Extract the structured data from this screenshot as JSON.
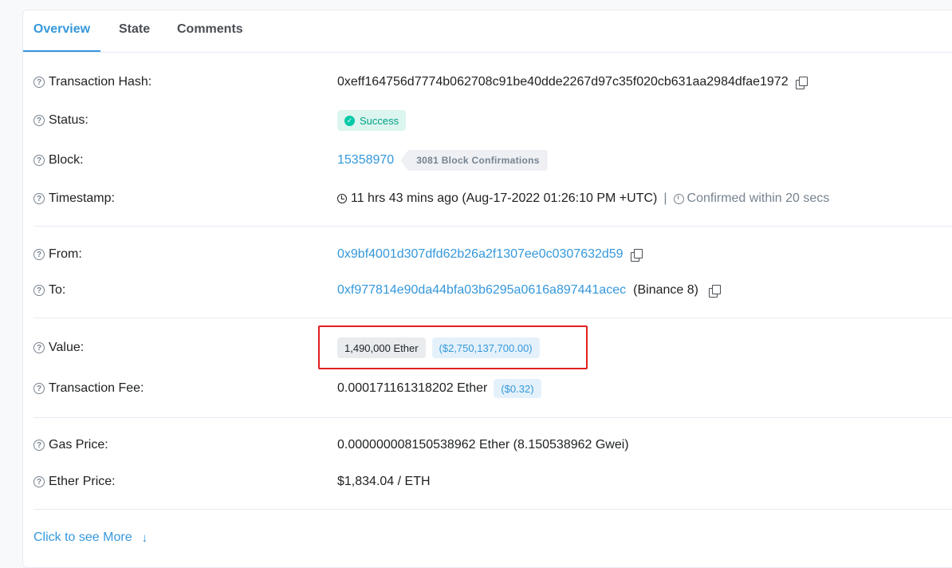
{
  "tabs": [
    "Overview",
    "State",
    "Comments"
  ],
  "rows": {
    "tx_hash": {
      "label": "Transaction Hash:",
      "value": "0xeff164756d7774b062708c91be40dde2267d97c35f020cb631aa2984dfae1972"
    },
    "status": {
      "label": "Status:",
      "value": "Success"
    },
    "block": {
      "label": "Block:",
      "value": "15358970",
      "confirmations": "3081 Block Confirmations"
    },
    "timestamp": {
      "label": "Timestamp:",
      "value": "11 hrs 43 mins ago (Aug-17-2022 01:26:10 PM +UTC)",
      "separator": "|",
      "confirmed": "Confirmed within 20 secs"
    },
    "from": {
      "label": "From:",
      "value": "0x9bf4001d307dfd62b26a2f1307ee0c0307632d59"
    },
    "to": {
      "label": "To:",
      "value": "0xf977814e90da44bfa03b6295a0616a897441acec",
      "name": "(Binance 8)"
    },
    "value": {
      "label": "Value:",
      "amount": "1,490,000 Ether",
      "usd": "($2,750,137,700.00)"
    },
    "fee": {
      "label": "Transaction Fee:",
      "amount": "0.000171161318202 Ether",
      "usd": "($0.32)"
    },
    "gas_price": {
      "label": "Gas Price:",
      "value": "0.000000008150538962 Ether (8.150538962 Gwei)"
    },
    "ether_price": {
      "label": "Ether Price:",
      "value": "$1,834.04 / ETH"
    }
  },
  "more": {
    "label": "Click to see More"
  },
  "icons": {
    "help": "question-circle-icon",
    "copy": "copy-icon",
    "check": "check-circle-icon",
    "clock": "clock-icon",
    "timer": "stopwatch-icon",
    "arrow": "arrow-down-icon"
  },
  "colors": {
    "link": "#3498db",
    "success_bg": "#dcf5ef",
    "success_text": "#00a186",
    "highlight": "#e02020"
  }
}
